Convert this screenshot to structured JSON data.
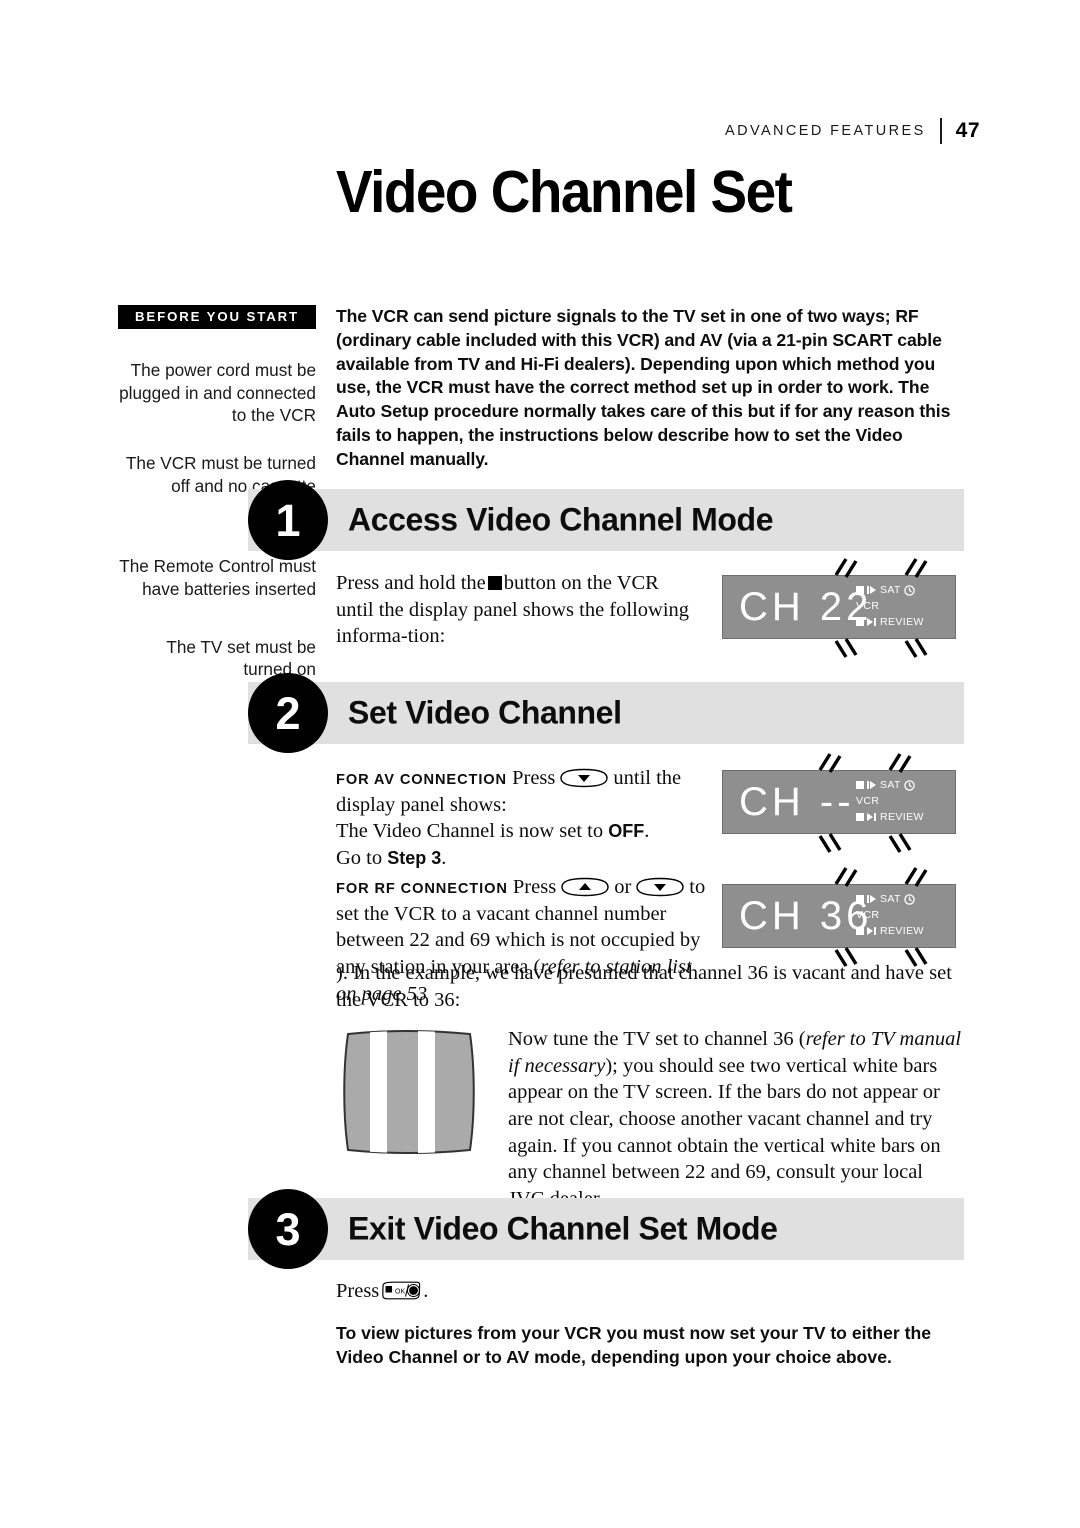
{
  "header": {
    "section": "ADVANCED FEATURES",
    "page_number": "47"
  },
  "page_title": "Video Channel Set",
  "sidebar": {
    "badge": "BEFORE YOU START",
    "items": [
      "The power cord must be plugged in and connected to the VCR",
      "The VCR must be turned off and no cassette inserted",
      "The Remote Control must have batteries inserted",
      "The TV set must be turned on"
    ]
  },
  "intro": "The VCR can send picture signals to the TV set in one of two ways; RF (ordinary cable included with this VCR) and AV (via a 21-pin SCART cable available from TV and Hi-Fi dealers). Depending upon which method you use, the VCR must have the correct method set up in order to work. The Auto Setup procedure normally takes care of this but if for any reason this fails to happen, the instructions below describe how to set the Video Channel manually.",
  "steps": [
    {
      "number": "1",
      "title": "Access Video Channel Mode"
    },
    {
      "number": "2",
      "title": "Set Video Channel"
    },
    {
      "number": "3",
      "title": "Exit Video Channel Set Mode"
    }
  ],
  "step1": {
    "text_before_glyph": "Press and hold the",
    "glyph": "stop-button-icon",
    "text_after_glyph": "button on the VCR until the display panel shows the following informa-tion:"
  },
  "step2": {
    "av": {
      "label": "FOR AV CONNECTION",
      "press_word": "Press",
      "glyph": "channel-down-button-icon",
      "after_glyph": "until the display panel shows:",
      "line2_a": "The Video Channel is now set to ",
      "line2_bold": "OFF",
      "line2_b": ".",
      "line3_a": "Go to ",
      "line3_bold": "Step 3",
      "line3_b": "."
    },
    "rf": {
      "label": "FOR RF CONNECTION",
      "press_word": "Press",
      "glyph_up": "channel-up-button-icon",
      "or_word": "or",
      "glyph_down": "channel-down-button-icon",
      "after_glyph": "to set the VCR to a vacant channel number between 22 and 69 which is not occupied by any station in your area (",
      "italic_part": "refer to station list on page 53",
      "tail": "). In the example, we have presumed that channel 36 is vacant and have set the VCR to 36:"
    },
    "tv_note": {
      "part1": "Now tune the TV set to channel 36 (",
      "italic": "refer to TV manual if necessary",
      "part2": "); you should see two vertical white bars appear on the TV screen. If the bars do not appear or are not clear, choose another vacant channel and try again. If you cannot obtain the vertical white bars on any channel between 22 and 69, consult your local JVC dealer."
    }
  },
  "step3": {
    "press_word": "Press",
    "glyph": "ok-button-icon",
    "period": "."
  },
  "closing": "To view pictures from your VCR you must now set your TV to either the Video Channel or to AV mode, depending upon your choice above.",
  "displays": [
    {
      "name": "display-ch22",
      "segments": "CH 22",
      "indicators": [
        "SAT",
        "VCR",
        "REVIEW"
      ],
      "flashing": true
    },
    {
      "name": "display-ch-off",
      "segments": "CH --",
      "indicators": [
        "SAT",
        "VCR",
        "REVIEW"
      ],
      "flashing": true
    },
    {
      "name": "display-ch36",
      "segments": "CH 36",
      "indicators": [
        "SAT",
        "VCR",
        "REVIEW"
      ],
      "flashing": true
    }
  ],
  "colors": {
    "banner_gray": "#e0e0e0",
    "display_gray": "#8f8f8f",
    "ink": "#000000"
  }
}
